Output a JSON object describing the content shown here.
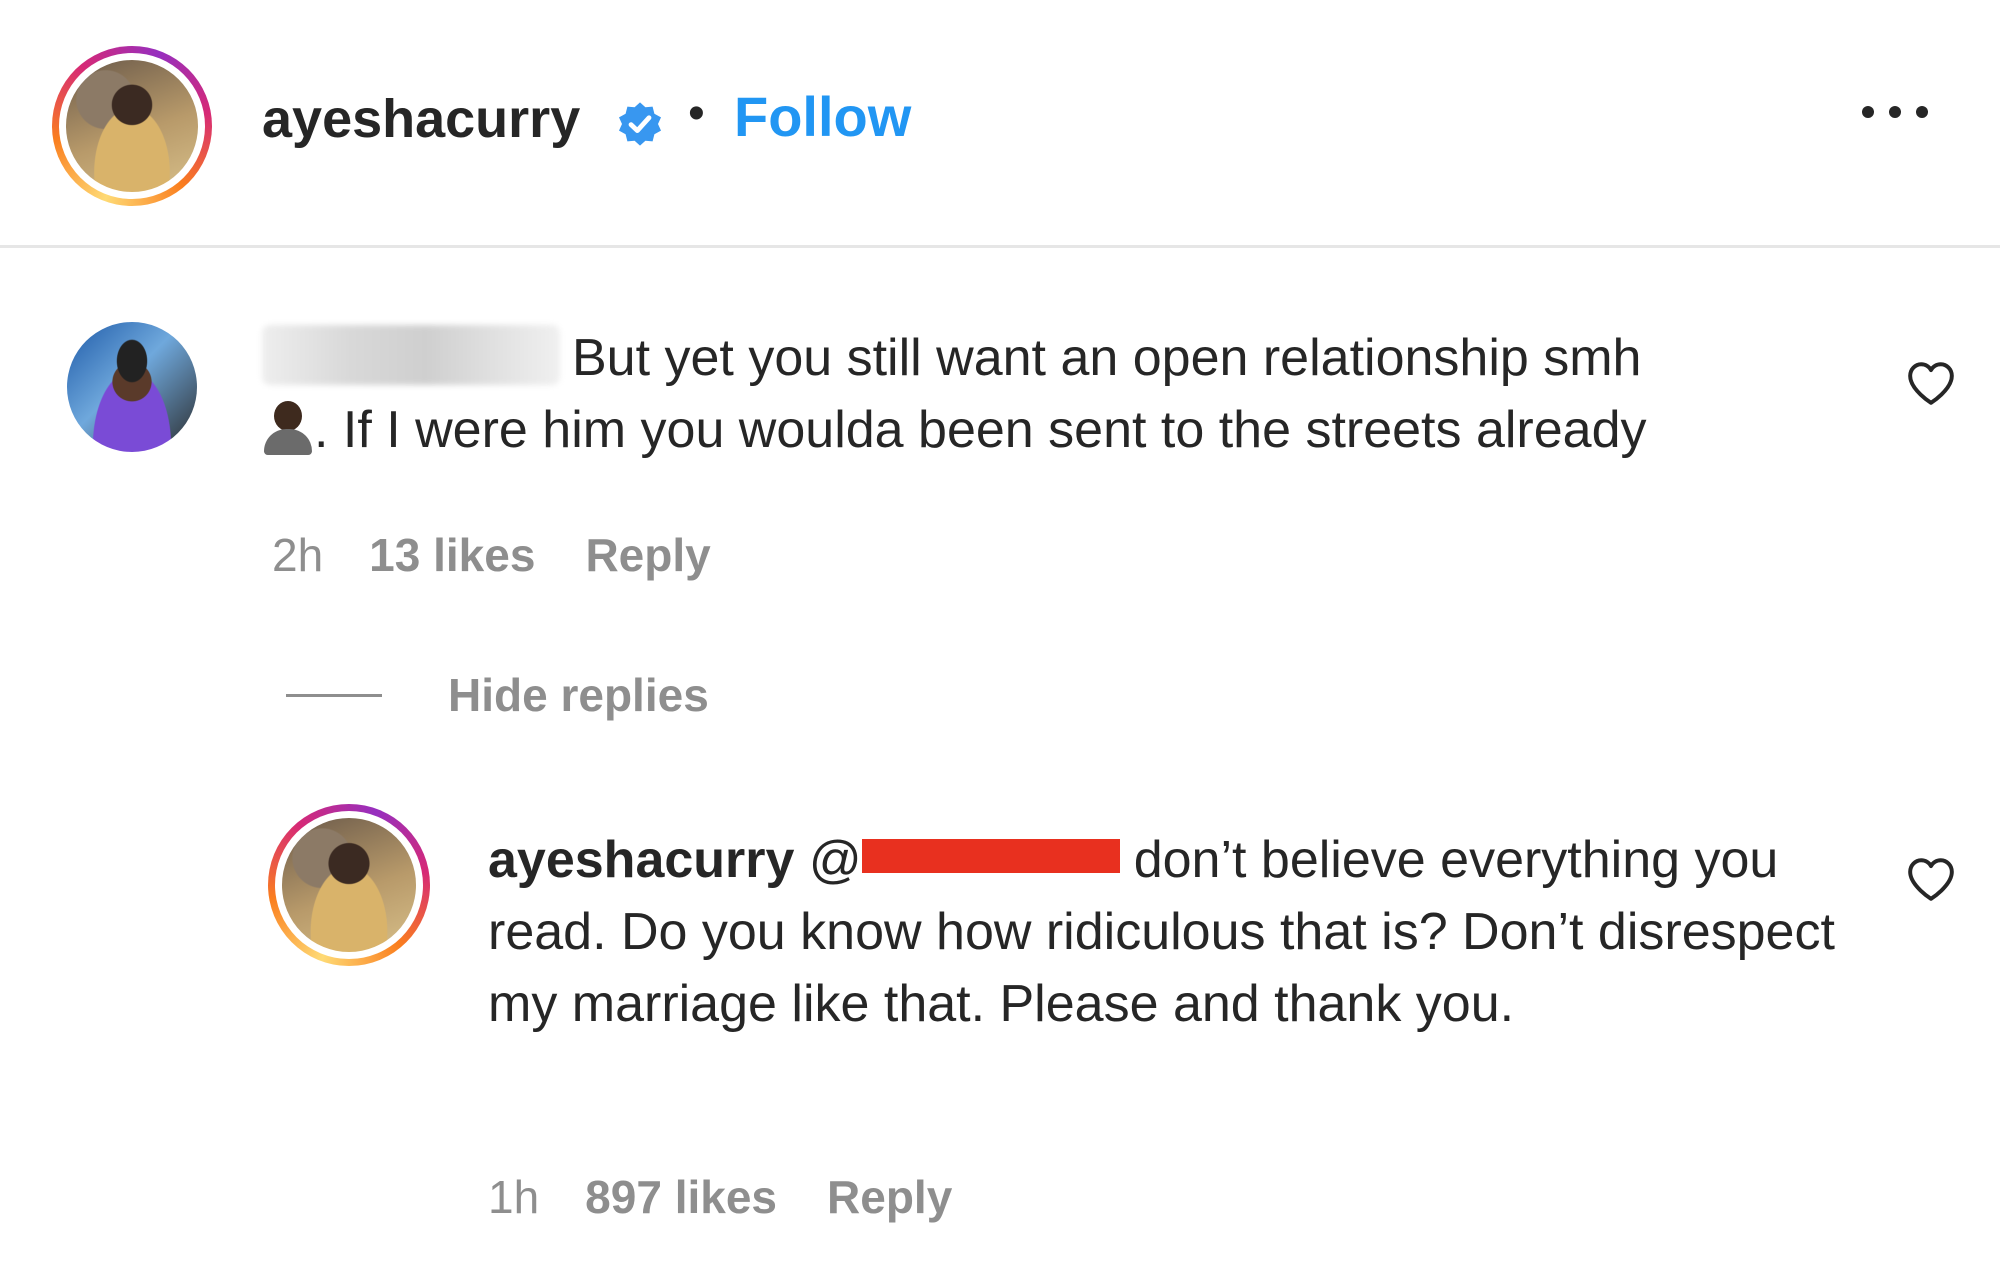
{
  "post_header": {
    "username": "ayeshacurry",
    "separator": "•",
    "follow_label": "Follow",
    "follow_color": "#2196f3"
  },
  "comments": [
    {
      "username_hidden": true,
      "text_line1": "But yet you still want an open relationship smh",
      "emoji": "person-shrugging-emoji",
      "text_line2": ". If I were him you woulda been sent to the streets already",
      "time": "2h",
      "likes": "13 likes",
      "reply_label": "Reply"
    }
  ],
  "hide_replies_label": "Hide replies",
  "reply": {
    "username": "ayeshacurry",
    "mention_prefix": "@",
    "mention_redacted": true,
    "text": "don’t believe everything you read. Do you know how ridiculous that is? Don’t disrespect my marriage like that. Please and thank you.",
    "time": "1h",
    "likes": "897 likes",
    "reply_label": "Reply"
  },
  "colors": {
    "text": "#262626",
    "muted": "#8e8e8e",
    "verified_badge": "#3897f0",
    "redaction": "#e8301f"
  }
}
